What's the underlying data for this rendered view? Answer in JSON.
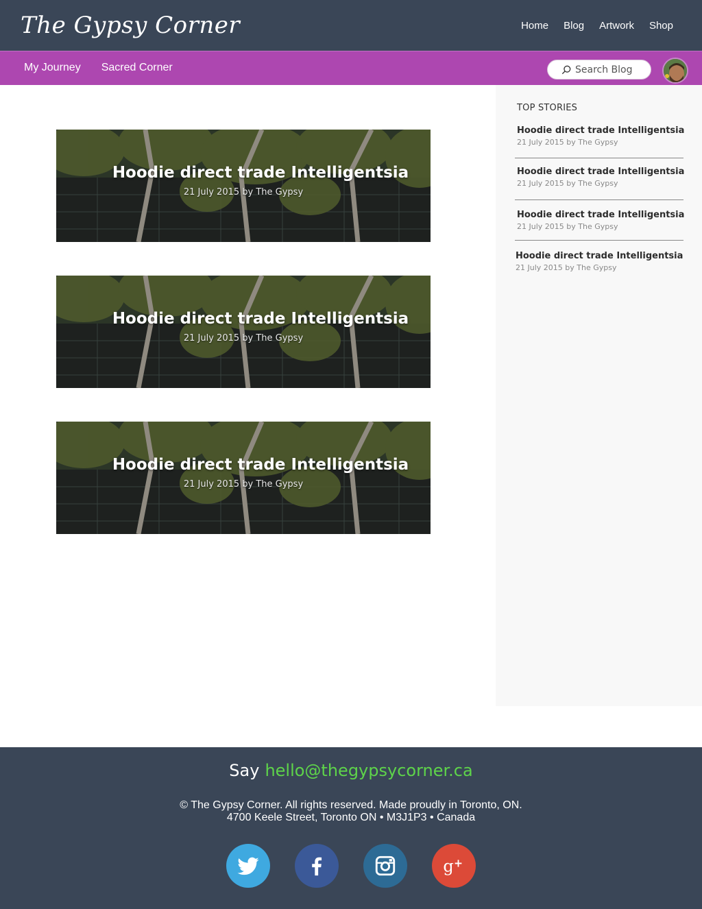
{
  "header": {
    "logo": "The Gypsy Corner",
    "nav": [
      "Home",
      "Blog",
      "Artwork",
      "Shop"
    ]
  },
  "subnav": {
    "items": [
      "My Journey",
      "Sacred Corner"
    ],
    "search_placeholder": "Search Blog"
  },
  "posts": [
    {
      "title": "Hoodie direct trade Intelligentsia",
      "meta": "21 July 2015 by The Gypsy"
    },
    {
      "title": "Hoodie direct trade Intelligentsia",
      "meta": "21 July 2015 by The Gypsy"
    },
    {
      "title": "Hoodie direct trade Intelligentsia",
      "meta": "21 July 2015 by The Gypsy"
    }
  ],
  "sidebar": {
    "heading": "TOP STORIES",
    "stories": [
      {
        "title": "Hoodie direct trade Intelligentsia",
        "meta": "21 July 2015 by The Gypsy"
      },
      {
        "title": "Hoodie direct trade Intelligentsia",
        "meta": "21 July 2015 by The Gypsy"
      },
      {
        "title": "Hoodie direct trade Intelligentsia",
        "meta": "21 July 2015 by The Gypsy"
      },
      {
        "title": "Hoodie direct trade Intelligentsia",
        "meta": "21 July 2015 by The Gypsy"
      }
    ]
  },
  "footer": {
    "say": "Say",
    "email": "hello@thegypsycorner.ca",
    "copyright": "© The Gypsy Corner. All rights reserved. Made proudly in Toronto, ON.",
    "address": "4700 Keele Street, Toronto ON • M3J1P3 • Canada",
    "socials": [
      {
        "icon": "twitter-icon",
        "color": "#3fa9e0"
      },
      {
        "icon": "facebook-icon",
        "color": "#3b5998"
      },
      {
        "icon": "instagram-icon",
        "color": "#2d6b95"
      },
      {
        "icon": "google-plus-icon",
        "color": "#dc4a38"
      }
    ]
  },
  "colors": {
    "header_bg": "#3a4657",
    "subnav_bg": "#ad47b0",
    "email_green": "#5ed44a",
    "sidebar_bg": "#f8f8f8"
  }
}
